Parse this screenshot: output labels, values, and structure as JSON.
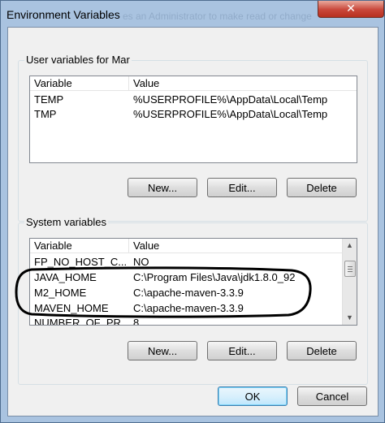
{
  "window": {
    "title": "Environment Variables",
    "title_ghost_text": "es an Administrator to make read or change",
    "close_glyph": "✕"
  },
  "user_vars": {
    "group_label": "User variables for Mar",
    "columns": {
      "variable": "Variable",
      "value": "Value"
    },
    "rows": [
      {
        "variable": "TEMP",
        "value": "%USERPROFILE%\\AppData\\Local\\Temp"
      },
      {
        "variable": "TMP",
        "value": "%USERPROFILE%\\AppData\\Local\\Temp"
      }
    ],
    "buttons": {
      "new": "New...",
      "edit": "Edit...",
      "delete": "Delete"
    }
  },
  "system_vars": {
    "group_label": "System variables",
    "columns": {
      "variable": "Variable",
      "value": "Value"
    },
    "rows": [
      {
        "variable": "FP_NO_HOST_C...",
        "value": "NO"
      },
      {
        "variable": "JAVA_HOME",
        "value": "C:\\Program Files\\Java\\jdk1.8.0_92"
      },
      {
        "variable": "M2_HOME",
        "value": "C:\\apache-maven-3.3.9"
      },
      {
        "variable": "MAVEN_HOME",
        "value": "C:\\apache-maven-3.3.9"
      },
      {
        "variable": "NUMBER_OF_PR...",
        "value": "8"
      }
    ],
    "buttons": {
      "new": "New...",
      "edit": "Edit...",
      "delete": "Delete"
    },
    "scrollbar": {
      "up_glyph": "▲",
      "down_glyph": "▼"
    }
  },
  "dialog_buttons": {
    "ok": "OK",
    "cancel": "Cancel"
  },
  "colors": {
    "title_bar": "#a9c3e0",
    "close_button": "#c9473a",
    "highlight_ellipse": "#000000"
  }
}
